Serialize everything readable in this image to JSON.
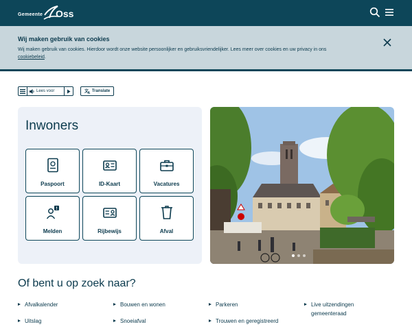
{
  "header": {
    "logo_small": "Gemeente",
    "logo_big": "Oss",
    "search_icon": "search-icon",
    "menu_icon": "hamburger-menu-icon"
  },
  "cookie": {
    "title": "Wij maken gebruik van cookies",
    "text": "Wij maken gebruik van cookies. Hierdoor wordt onze website persoonlijker en gebruiksvriendelijker. Lees meer over cookies en uw privacy in ons ",
    "link": "cookiebeleid",
    "after_link": ".",
    "close_icon": "close-icon"
  },
  "toolbar": {
    "read_label": "Lees voor",
    "translate_label": "Translate"
  },
  "inwoners": {
    "title": "Inwoners",
    "tiles": [
      {
        "label": "Paspoort",
        "icon": "passport-icon"
      },
      {
        "label": "ID-Kaart",
        "icon": "id-card-icon"
      },
      {
        "label": "Vacatures",
        "icon": "briefcase-icon"
      },
      {
        "label": "Melden",
        "icon": "report-icon"
      },
      {
        "label": "Rijbewijs",
        "icon": "drivers-license-icon"
      },
      {
        "label": "Afval",
        "icon": "waste-bin-icon"
      }
    ]
  },
  "search": {
    "title": "Of bent u op zoek naar?",
    "links": [
      "Afvalkalender",
      "Bouwen en wonen",
      "Parkeren",
      "Live uitzendingen gemeenteraad",
      "Uitslag",
      "Snoeiafval",
      "Trouwen en geregistreerd"
    ]
  },
  "colors": {
    "brand": "#0d4659",
    "cookie_bg": "#c8d6dc",
    "panel_bg": "#edf1f8"
  }
}
